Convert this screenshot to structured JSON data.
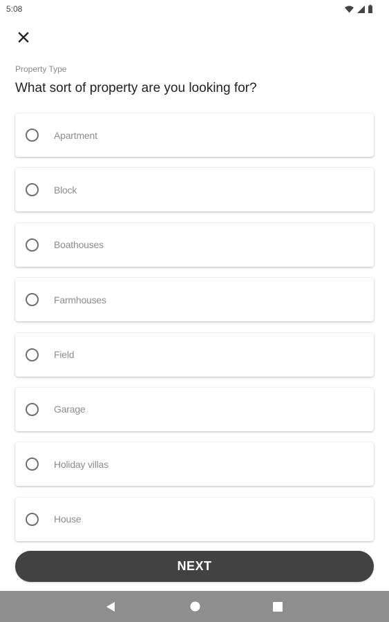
{
  "status_bar": {
    "time": "5:08",
    "icons": [
      "wifi-icon",
      "cell-signal-icon",
      "battery-icon"
    ]
  },
  "header": {
    "close_icon": "close-icon",
    "eyebrow": "Property Type",
    "question": "What sort of property are you looking for?"
  },
  "options": [
    {
      "label": "Apartment",
      "selected": false
    },
    {
      "label": "Block",
      "selected": false
    },
    {
      "label": "Boathouses",
      "selected": false
    },
    {
      "label": "Farmhouses",
      "selected": false
    },
    {
      "label": "Field",
      "selected": false
    },
    {
      "label": "Garage",
      "selected": false
    },
    {
      "label": "Holiday villas",
      "selected": false
    },
    {
      "label": "House",
      "selected": false
    }
  ],
  "footer": {
    "next_label": "NEXT"
  },
  "nav_bar": {
    "buttons": [
      "back-icon",
      "home-icon",
      "recents-icon"
    ]
  },
  "colors": {
    "button_bg": "#424242",
    "nav_bar_bg": "#8e8e8e",
    "option_text": "#8d8d8d",
    "question_text": "#222222"
  }
}
